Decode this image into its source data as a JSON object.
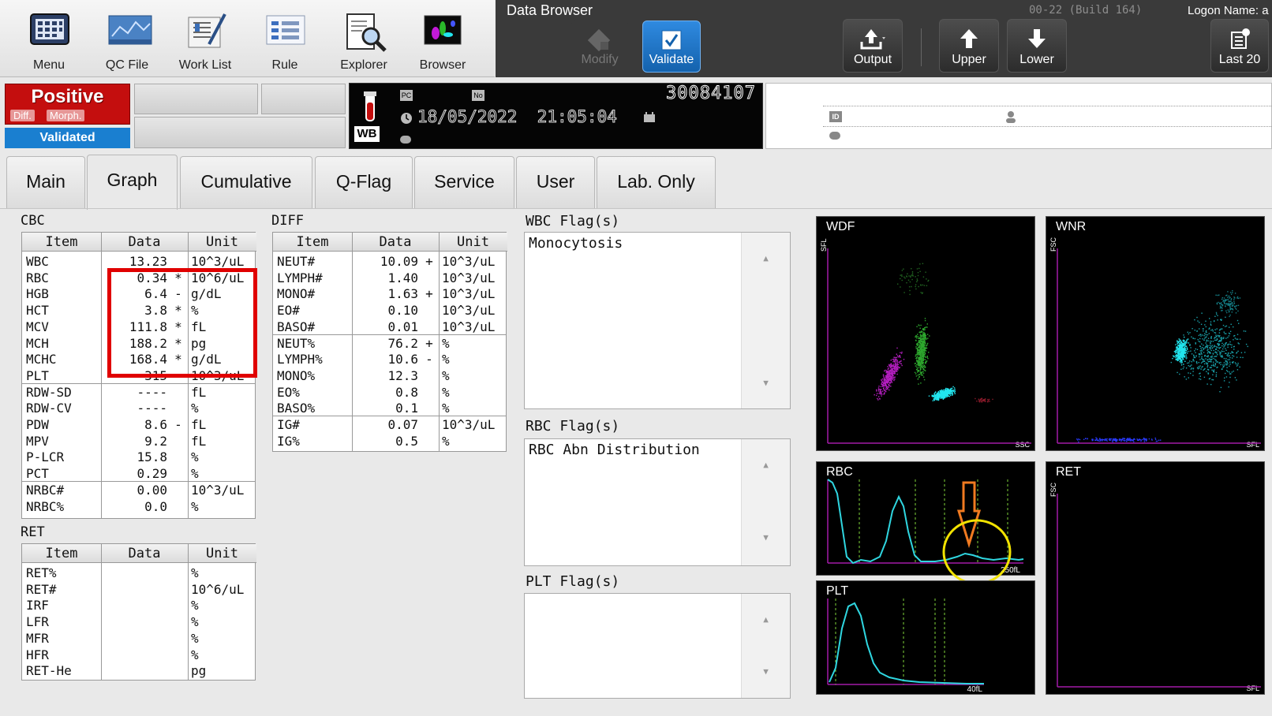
{
  "toolbar": {
    "items": [
      {
        "label": "Menu",
        "icon": "menu-grid-icon"
      },
      {
        "label": "QC File",
        "icon": "qc-chart-icon"
      },
      {
        "label": "Work List",
        "icon": "worklist-icon"
      },
      {
        "label": "Rule",
        "icon": "rule-icon"
      },
      {
        "label": "Explorer",
        "icon": "explorer-magnifier-icon"
      },
      {
        "label": "Browser",
        "icon": "browser-scatter-icon"
      }
    ]
  },
  "data_browser": {
    "title": "Data Browser",
    "build": "00-22 (Build 164)",
    "logon": "Logon Name: a",
    "modify_label": "Modify",
    "validate_label": "Validate",
    "output_label": "Output",
    "upper_label": "Upper",
    "lower_label": "Lower",
    "last20_label": "Last 20"
  },
  "status": {
    "result": "Positive",
    "diff_label": "Diff.",
    "morph_label": "Morph.",
    "validated": "Validated"
  },
  "sample": {
    "number": "30084107",
    "datetime": "18/05/2022  21:05:04",
    "mode": "WB",
    "pc_label": "PC",
    "no_label": "No"
  },
  "patient": {
    "id_label": "ID"
  },
  "tabs": [
    "Main",
    "Graph",
    "Cumulative",
    "Q-Flag",
    "Service",
    "User",
    "Lab. Only"
  ],
  "cbc": {
    "title": "CBC",
    "headers": [
      "Item",
      "Data",
      "Unit"
    ],
    "rows": [
      {
        "item": "WBC",
        "data": "13.23",
        "flag": "",
        "unit": "10^3/uL"
      },
      {
        "item": "RBC",
        "data": "0.34",
        "flag": "*",
        "unit": "10^6/uL"
      },
      {
        "item": "HGB",
        "data": "6.4",
        "flag": "-",
        "unit": "g/dL"
      },
      {
        "item": "HCT",
        "data": "3.8",
        "flag": "*",
        "unit": "%"
      },
      {
        "item": "MCV",
        "data": "111.8",
        "flag": "*",
        "unit": "fL"
      },
      {
        "item": "MCH",
        "data": "188.2",
        "flag": "*",
        "unit": "pg"
      },
      {
        "item": "MCHC",
        "data": "168.4",
        "flag": "*",
        "unit": "g/dL"
      },
      {
        "item": "PLT",
        "data": "315",
        "flag": "",
        "unit": "10^3/uL"
      },
      {
        "item": "RDW-SD",
        "data": "----",
        "flag": "",
        "unit": "fL"
      },
      {
        "item": "RDW-CV",
        "data": "----",
        "flag": "",
        "unit": "%"
      },
      {
        "item": "PDW",
        "data": "8.6",
        "flag": "-",
        "unit": "fL"
      },
      {
        "item": "MPV",
        "data": "9.2",
        "flag": "",
        "unit": "fL"
      },
      {
        "item": "P-LCR",
        "data": "15.8",
        "flag": "",
        "unit": "%"
      },
      {
        "item": "PCT",
        "data": "0.29",
        "flag": "",
        "unit": "%"
      },
      {
        "item": "NRBC#",
        "data": "0.00",
        "flag": "",
        "unit": "10^3/uL"
      },
      {
        "item": "NRBC%",
        "data": "0.0",
        "flag": "",
        "unit": "%"
      }
    ]
  },
  "diff": {
    "title": "DIFF",
    "headers": [
      "Item",
      "Data",
      "Unit"
    ],
    "rows": [
      {
        "item": "NEUT#",
        "data": "10.09",
        "flag": "+",
        "unit": "10^3/uL"
      },
      {
        "item": "LYMPH#",
        "data": "1.40",
        "flag": "",
        "unit": "10^3/uL"
      },
      {
        "item": "MONO#",
        "data": "1.63",
        "flag": "+",
        "unit": "10^3/uL"
      },
      {
        "item": "EO#",
        "data": "0.10",
        "flag": "",
        "unit": "10^3/uL"
      },
      {
        "item": "BASO#",
        "data": "0.01",
        "flag": "",
        "unit": "10^3/uL"
      },
      {
        "item": "NEUT%",
        "data": "76.2",
        "flag": "+",
        "unit": "%"
      },
      {
        "item": "LYMPH%",
        "data": "10.6",
        "flag": "-",
        "unit": "%"
      },
      {
        "item": "MONO%",
        "data": "12.3",
        "flag": "",
        "unit": "%"
      },
      {
        "item": "EO%",
        "data": "0.8",
        "flag": "",
        "unit": "%"
      },
      {
        "item": "BASO%",
        "data": "0.1",
        "flag": "",
        "unit": "%"
      },
      {
        "item": "IG#",
        "data": "0.07",
        "flag": "",
        "unit": "10^3/uL"
      },
      {
        "item": "IG%",
        "data": "0.5",
        "flag": "",
        "unit": "%"
      }
    ]
  },
  "ret": {
    "title": "RET",
    "headers": [
      "Item",
      "Data",
      "Unit"
    ],
    "rows": [
      {
        "item": "RET%",
        "data": "",
        "flag": "",
        "unit": "%"
      },
      {
        "item": "RET#",
        "data": "",
        "flag": "",
        "unit": "10^6/uL"
      },
      {
        "item": "IRF",
        "data": "",
        "flag": "",
        "unit": "%"
      },
      {
        "item": "LFR",
        "data": "",
        "flag": "",
        "unit": "%"
      },
      {
        "item": "MFR",
        "data": "",
        "flag": "",
        "unit": "%"
      },
      {
        "item": "HFR",
        "data": "",
        "flag": "",
        "unit": "%"
      },
      {
        "item": "RET-He",
        "data": "",
        "flag": "",
        "unit": "pg"
      }
    ]
  },
  "flags": {
    "wbc_title": "WBC Flag(s)",
    "wbc_text": "Monocytosis",
    "rbc_title": "RBC Flag(s)",
    "rbc_text": "RBC Abn Distribution",
    "plt_title": "PLT Flag(s)",
    "plt_text": ""
  },
  "graphs": {
    "wdf": {
      "title": "WDF",
      "y": "SFL",
      "x": "SSC"
    },
    "wnr": {
      "title": "WNR",
      "y": "FSC",
      "x": "SFL"
    },
    "rbc": {
      "title": "RBC",
      "x_end": "250fL"
    },
    "plt": {
      "title": "PLT",
      "x_end": "40fL"
    },
    "ret": {
      "title": "RET",
      "y": "FSC",
      "x": "SFL"
    }
  },
  "colors": {
    "positive": "#c40e0e",
    "validated": "#1a7fd0",
    "histogram": "#2fd6e0",
    "annotation_box": "#e00000",
    "annotation_circle": "#f2e200",
    "annotation_arrow": "#f07a20"
  }
}
